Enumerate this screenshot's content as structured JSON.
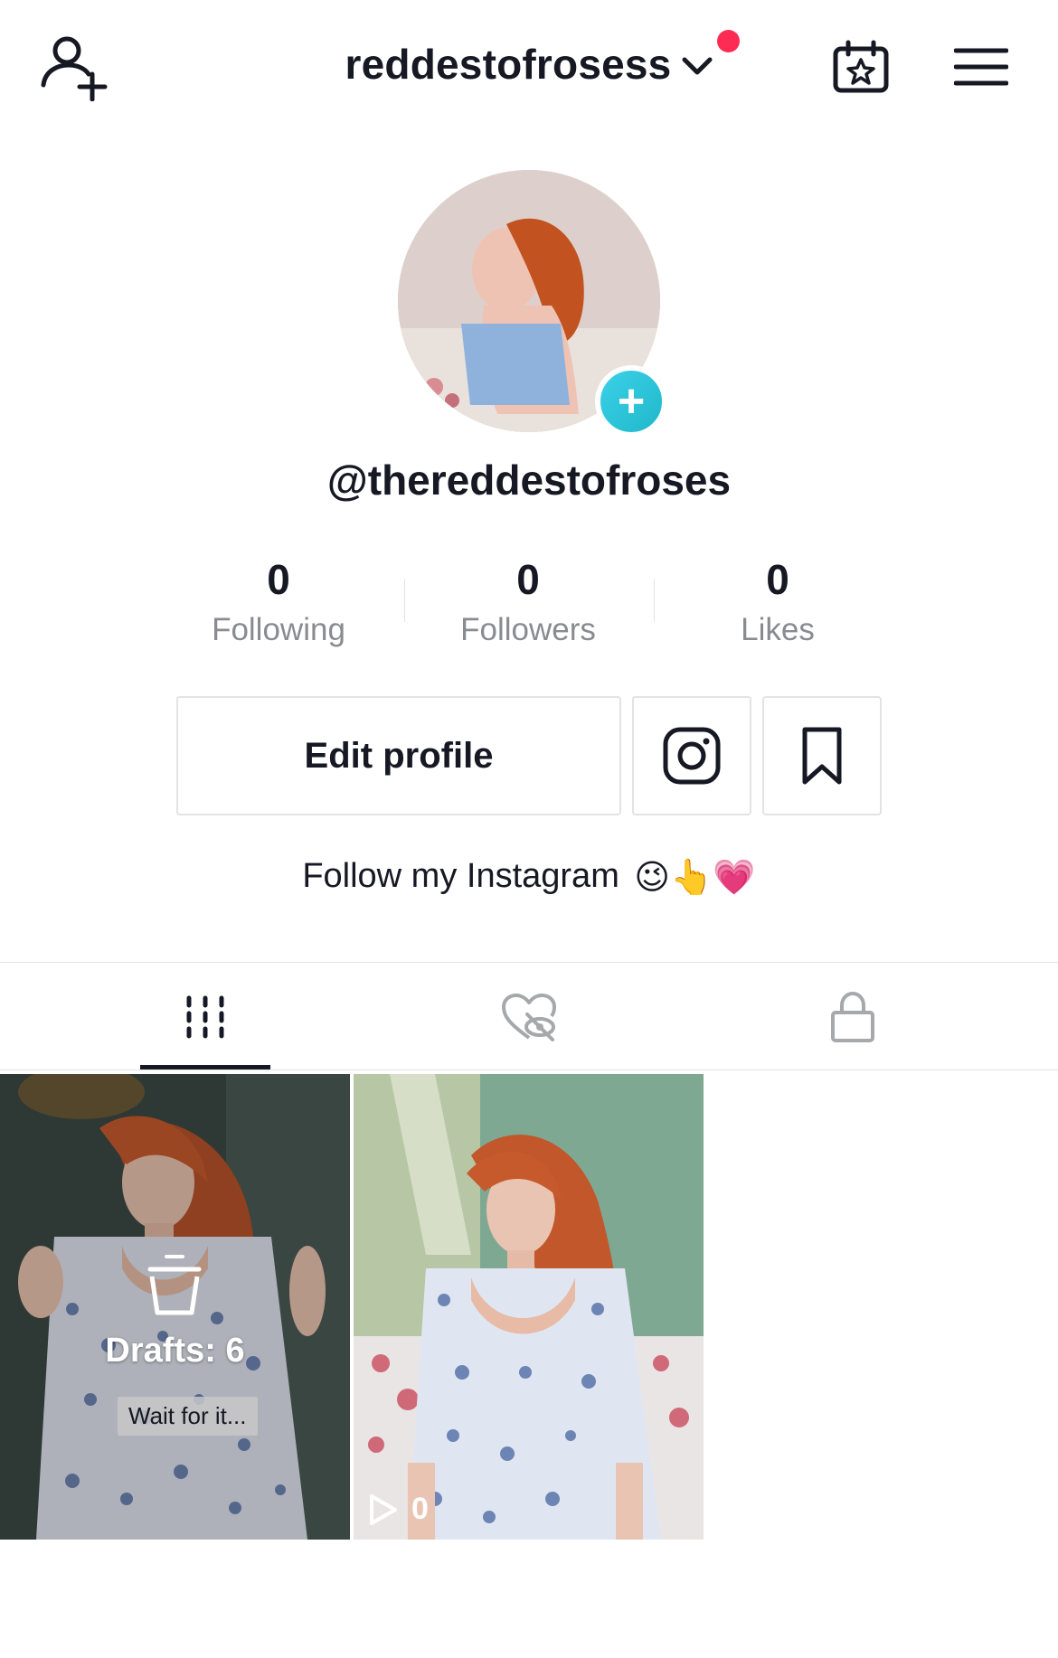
{
  "header": {
    "username": "reddestofrosess",
    "add_friend_icon": "add-user-icon",
    "calendar_icon": "calendar-star-icon",
    "menu_icon": "hamburger-menu-icon",
    "notification_color": "#fe2c55"
  },
  "profile": {
    "handle": "@thereddestofroses",
    "stats": [
      {
        "value": "0",
        "label": "Following"
      },
      {
        "value": "0",
        "label": "Followers"
      },
      {
        "value": "0",
        "label": "Likes"
      }
    ],
    "edit_profile_label": "Edit profile",
    "instagram_icon": "instagram-icon",
    "bookmark_icon": "bookmark-icon",
    "bio": "Follow my Instagram",
    "bio_emojis": "😉👆💗"
  },
  "tabs": [
    {
      "name": "videos",
      "icon": "grid-columns-icon",
      "active": true
    },
    {
      "name": "liked",
      "icon": "hidden-heart-icon",
      "active": false
    },
    {
      "name": "private",
      "icon": "lock-icon",
      "active": false
    }
  ],
  "grid": {
    "draft_label": "Drafts: 6",
    "draft_caption": "Wait for it...",
    "video_views": "0"
  },
  "colors": {
    "accent": "#fe2c55",
    "avatar_add": "#20d5ec",
    "secondary_text": "#8a8b91",
    "border": "#e3e3e4"
  }
}
